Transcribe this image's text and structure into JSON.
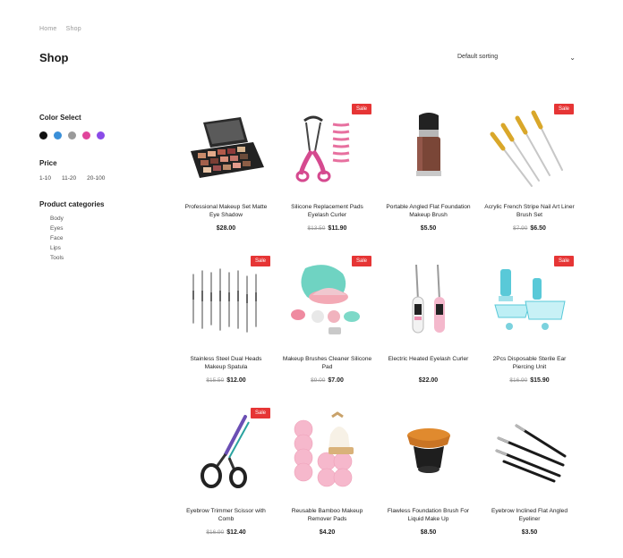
{
  "breadcrumb": [
    "Home",
    "Shop"
  ],
  "page_title": "Shop",
  "sorting": {
    "label": "Default sorting"
  },
  "sidebar": {
    "color_heading": "Color Select",
    "colors": [
      "#111111",
      "#3a8fd8",
      "#9a9a9a",
      "#e0459b",
      "#8a4be8"
    ],
    "price_heading": "Price",
    "price_ranges": [
      "1-10",
      "11-20",
      "20-100"
    ],
    "categories_heading": "Product categories",
    "categories": [
      "Body",
      "Eyes",
      "Face",
      "Lips",
      "Tools"
    ]
  },
  "sale_label": "Sale",
  "products": [
    {
      "name": "Professional Makeup Set Matte Eye Shadow",
      "old_price": "",
      "price": "$28.00",
      "sale": false,
      "icon": "eyeshadow-palette-icon"
    },
    {
      "name": "Silicone Replacement Pads Eyelash Curler",
      "old_price": "$13.50",
      "price": "$11.90",
      "sale": true,
      "icon": "eyelash-curler-icon"
    },
    {
      "name": "Portable Angled Flat Foundation Makeup Brush",
      "old_price": "",
      "price": "$5.50",
      "sale": false,
      "icon": "foundation-brush-icon"
    },
    {
      "name": "Acrylic French Stripe Nail Art Liner Brush Set",
      "old_price": "$7.90",
      "price": "$6.50",
      "sale": true,
      "icon": "nail-liner-brushes-icon"
    },
    {
      "name": "Stainless Steel Dual Heads Makeup Spatula",
      "old_price": "$15.50",
      "price": "$12.00",
      "sale": true,
      "icon": "steel-spatula-icon"
    },
    {
      "name": "Makeup Brushes Cleaner Silicone Pad",
      "old_price": "$9.00",
      "price": "$7.00",
      "sale": true,
      "icon": "brush-cleaner-pad-icon"
    },
    {
      "name": "Electric Heated Eyelash Curler",
      "old_price": "",
      "price": "$22.00",
      "sale": false,
      "icon": "heated-curler-icon"
    },
    {
      "name": "2Pcs Disposable Sterile Ear Piercing Unit",
      "old_price": "$16.90",
      "price": "$15.90",
      "sale": true,
      "icon": "piercing-unit-icon"
    },
    {
      "name": "Eyebrow Trimmer Scissor with Comb",
      "old_price": "$16.90",
      "price": "$12.40",
      "sale": true,
      "icon": "scissor-icon"
    },
    {
      "name": "Reusable Bamboo Makeup Remover Pads",
      "old_price": "",
      "price": "$4.20",
      "sale": false,
      "icon": "remover-pads-icon"
    },
    {
      "name": "Flawless Foundation Brush For Liquid Make Up",
      "old_price": "",
      "price": "$8.50",
      "sale": false,
      "icon": "kabuki-brush-icon"
    },
    {
      "name": "Eyebrow Inclined Flat Angled Eyeliner",
      "old_price": "",
      "price": "$3.50",
      "sale": false,
      "icon": "eyeliner-brushes-icon"
    }
  ]
}
